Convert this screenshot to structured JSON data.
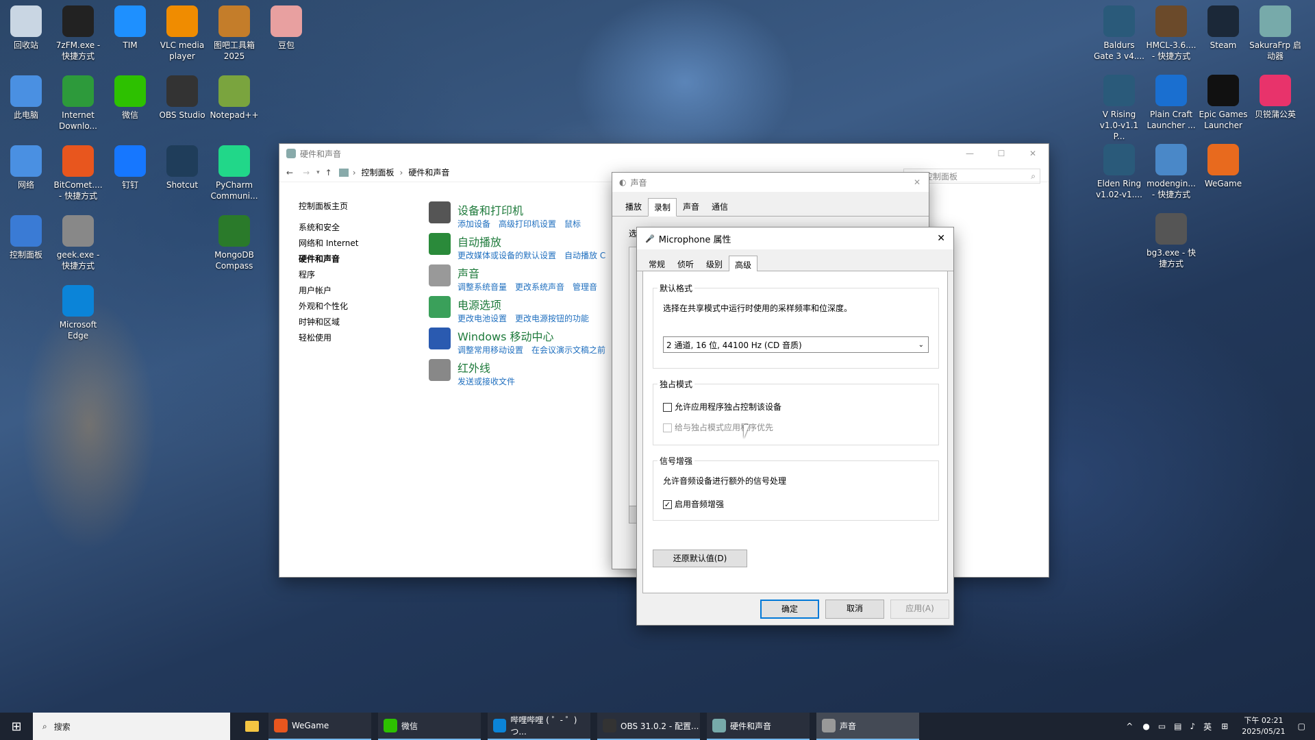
{
  "desktop_icons_left": [
    {
      "label": "回收站"
    },
    {
      "label": "7zFM.exe - 快捷方式"
    },
    {
      "label": "TIM"
    },
    {
      "label": "VLC media player"
    },
    {
      "label": "图吧工具箱2025"
    },
    {
      "label": "豆包"
    },
    {
      "label": "此电脑"
    },
    {
      "label": "Internet Downlo..."
    },
    {
      "label": "微信"
    },
    {
      "label": "OBS Studio"
    },
    {
      "label": "Notepad++"
    },
    {
      "label": "网络"
    },
    {
      "label": "BitComet.... - 快捷方式"
    },
    {
      "label": "钉钉"
    },
    {
      "label": "Shotcut"
    },
    {
      "label": "PyCharm Communi..."
    },
    {
      "label": "控制面板"
    },
    {
      "label": "geek.exe - 快捷方式"
    },
    {
      "label": "MongoDB Compass"
    },
    {
      "label": "Microsoft Edge"
    }
  ],
  "desktop_icons_right": [
    {
      "label": "Baldurs Gate 3 v4...."
    },
    {
      "label": "HMCL-3.6.... - 快捷方式"
    },
    {
      "label": "Steam"
    },
    {
      "label": "SakuraFrp 启动器"
    },
    {
      "label": "V Rising v1.0-v1.1 P..."
    },
    {
      "label": "Plain Craft Launcher ..."
    },
    {
      "label": "Epic Games Launcher"
    },
    {
      "label": "贝锐蒲公英"
    },
    {
      "label": "Elden Ring v1.02-v1...."
    },
    {
      "label": "modengin... - 快捷方式"
    },
    {
      "label": "WeGame"
    },
    {
      "label": "bg3.exe - 快捷方式"
    }
  ],
  "control_panel": {
    "title": "硬件和声音",
    "breadcrumb": [
      "控制面板",
      "硬件和声音"
    ],
    "search_placeholder": "搜索控制面板",
    "sidebar": [
      "控制面板主页",
      "系统和安全",
      "网络和 Internet",
      "硬件和声音",
      "程序",
      "用户帐户",
      "外观和个性化",
      "时钟和区域",
      "轻松使用"
    ],
    "categories": [
      {
        "title": "设备和打印机",
        "links": [
          "添加设备",
          "高级打印机设置",
          "鼠标"
        ]
      },
      {
        "title": "自动播放",
        "links": [
          "更改媒体或设备的默认设置",
          "自动播放 C"
        ]
      },
      {
        "title": "声音",
        "links": [
          "调整系统音量",
          "更改系统声音",
          "管理音"
        ]
      },
      {
        "title": "电源选项",
        "links": [
          "更改电池设置",
          "更改电源按钮的功能"
        ]
      },
      {
        "title": "Windows 移动中心",
        "links": [
          "调整常用移动设置",
          "在会议演示文稿之前"
        ]
      },
      {
        "title": "红外线",
        "links": [
          "发送或接收文件"
        ]
      }
    ]
  },
  "sound_dialog": {
    "title": "声音",
    "tabs": [
      "播放",
      "录制",
      "声音",
      "通信"
    ],
    "active_tab": "录制",
    "partial_text": "选"
  },
  "mic_dialog": {
    "title": "Microphone 属性",
    "tabs": [
      "常规",
      "侦听",
      "级别",
      "高级"
    ],
    "active_tab": "高级",
    "default_format": {
      "label": "默认格式",
      "desc": "选择在共享模式中运行时使用的采样频率和位深度。",
      "selected": "2 通道, 16 位, 44100 Hz (CD 音质)"
    },
    "exclusive": {
      "label": "独占模式",
      "allow": "允许应用程序独占控制该设备",
      "priority": "给与独占模式应用程序优先"
    },
    "enhancement": {
      "label": "信号增强",
      "desc": "允许音频设备进行额外的信号处理",
      "enable": "启用音频增强"
    },
    "restore": "还原默认值(D)",
    "ok": "确定",
    "cancel": "取消",
    "apply": "应用(A)"
  },
  "taskbar": {
    "search": "搜索",
    "items": [
      "WeGame",
      "微信",
      "哔哩哔哩 ( ゜- ゜)つ...",
      "OBS 31.0.2 - 配置...",
      "硬件和声音",
      "声音"
    ],
    "ime": "英",
    "time": "下午 02:21",
    "date": "2025/05/21"
  }
}
